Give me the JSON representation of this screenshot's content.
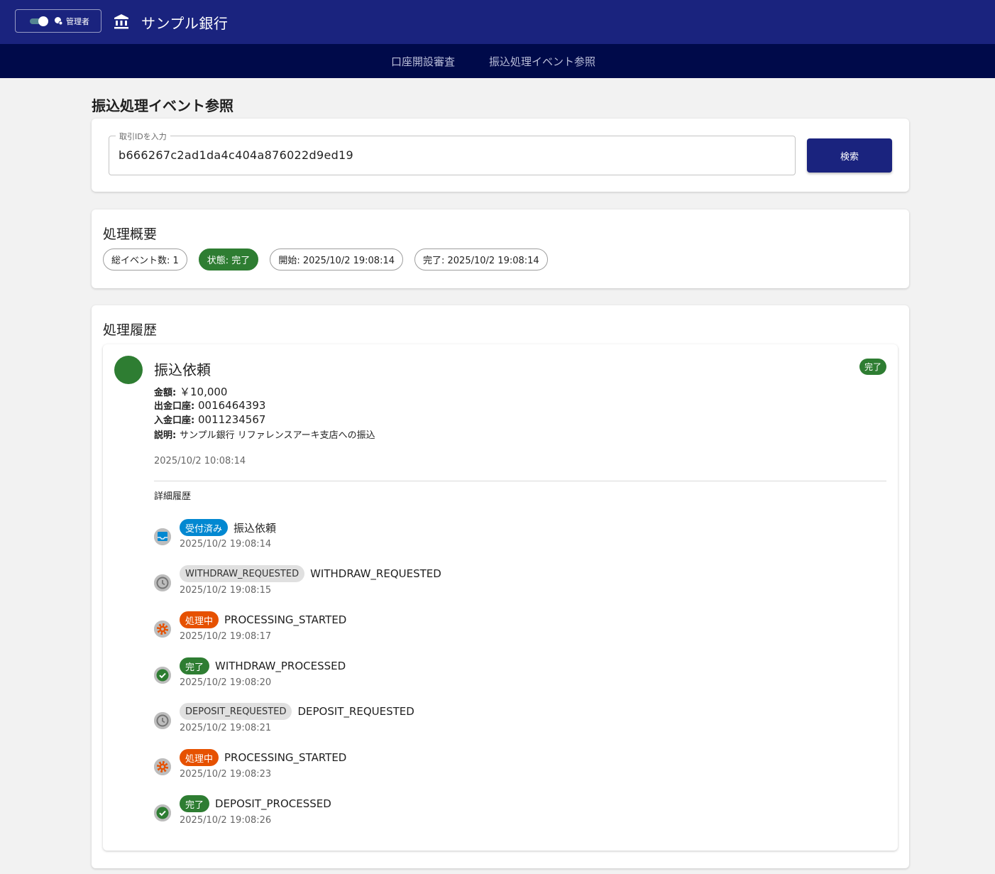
{
  "header": {
    "role_label": "管理者",
    "app_title": "サンプル銀行",
    "colors": {
      "primary": "#1a237e",
      "nav": "#000a4a"
    }
  },
  "nav": {
    "items": [
      "口座開設審査",
      "振込処理イベント参照"
    ]
  },
  "page": {
    "title": "振込処理イベント参照"
  },
  "search": {
    "label": "取引IDを入力",
    "value": "b666267c2ad1da4c404a876022d9ed19",
    "button_label": "検索"
  },
  "summary": {
    "title": "処理概要",
    "chips": [
      {
        "text": "総イベント数: 1",
        "style": "outlined"
      },
      {
        "text": "状態: 完了",
        "style": "success"
      },
      {
        "text": "開始: 2025/10/2 19:08:14",
        "style": "outlined"
      },
      {
        "text": "完了: 2025/10/2 19:08:14",
        "style": "outlined"
      }
    ]
  },
  "history": {
    "title": "処理履歴",
    "event": {
      "title": "振込依頼",
      "status": "完了",
      "fields": [
        {
          "label": "金額:",
          "value": "￥10,000"
        },
        {
          "label": "出金口座:",
          "value": "0016464393"
        },
        {
          "label": "入金口座:",
          "value": "0011234567"
        },
        {
          "label": "説明:",
          "value": "サンプル銀行 リファレンスアーキ支店への振込"
        }
      ],
      "timestamp": "2025/10/2 10:08:14",
      "detail_heading": "詳細履歴",
      "details": [
        {
          "icon": "inbox-icon",
          "badge": "受付済み",
          "badge_color": "#0288d1",
          "text": "振込依頼",
          "time": "2025/10/2 19:08:14"
        },
        {
          "icon": "clock-icon",
          "badge": "WITHDRAW_REQUESTED",
          "badge_color": "#e0e0e0",
          "text": "WITHDRAW_REQUESTED",
          "time": "2025/10/2 19:08:15"
        },
        {
          "icon": "gear-icon",
          "badge": "処理中",
          "badge_color": "#e65100",
          "text": "PROCESSING_STARTED",
          "time": "2025/10/2 19:08:17"
        },
        {
          "icon": "check-circle-icon",
          "badge": "完了",
          "badge_color": "#2e7d32",
          "text": "WITHDRAW_PROCESSED",
          "time": "2025/10/2 19:08:20"
        },
        {
          "icon": "clock-icon",
          "badge": "DEPOSIT_REQUESTED",
          "badge_color": "#e0e0e0",
          "text": "DEPOSIT_REQUESTED",
          "time": "2025/10/2 19:08:21"
        },
        {
          "icon": "gear-icon",
          "badge": "処理中",
          "badge_color": "#e65100",
          "text": "PROCESSING_STARTED",
          "time": "2025/10/2 19:08:23"
        },
        {
          "icon": "check-circle-icon",
          "badge": "完了",
          "badge_color": "#2e7d32",
          "text": "DEPOSIT_PROCESSED",
          "time": "2025/10/2 19:08:26"
        }
      ]
    }
  }
}
